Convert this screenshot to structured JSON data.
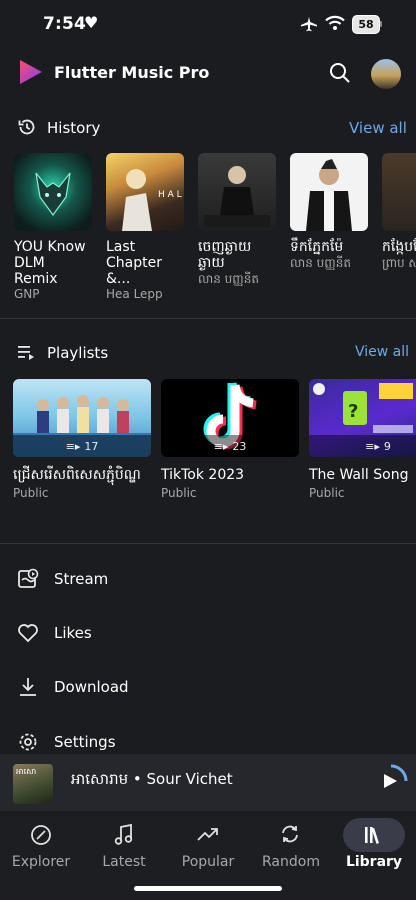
{
  "status_bar": {
    "time": "7:54",
    "battery": "58"
  },
  "app": {
    "title": "Flutter Music Pro"
  },
  "history": {
    "title": "History",
    "view_all": "View all",
    "items": [
      {
        "title": "YOU Know DLM Remix",
        "subtitle": "GNP"
      },
      {
        "title": "Last Chapter &...",
        "subtitle": "Hea Lepp"
      },
      {
        "title": "ចេញឆ្ងាយ ឆ្ងាយ",
        "subtitle": "លាន បញ្ញនីត"
      },
      {
        "title": "ទឹកភ្នែកម៉ែ",
        "subtitle": "លាន បញ្ញនីត"
      },
      {
        "title": "កង្កែបស្រែក",
        "subtitle": "ព្រាប ស"
      }
    ]
  },
  "playlists": {
    "title": "Playlists",
    "view_all": "View all",
    "items": [
      {
        "title": "ជ្រើសរើសពិសេសភ្ជុំបិណ្ឌ",
        "subtitle": "Public",
        "count": "17"
      },
      {
        "title": "TikTok 2023",
        "subtitle": "Public",
        "count": "23"
      },
      {
        "title": "The Wall Song",
        "subtitle": "Public",
        "count": "9"
      }
    ]
  },
  "menu": {
    "stream": "Stream",
    "likes": "Likes",
    "download": "Download",
    "settings": "Settings"
  },
  "player": {
    "now_playing": "អាសោរាម • Sour Vichet",
    "thumb_text": "អាសោ"
  },
  "nav": {
    "explorer": "Explorer",
    "latest": "Latest",
    "popular": "Popular",
    "random": "Random",
    "library": "Library"
  },
  "colors": {
    "accent": "#6ea8e8",
    "background": "#1b1c20",
    "nav_pill": "#3a3d49"
  }
}
